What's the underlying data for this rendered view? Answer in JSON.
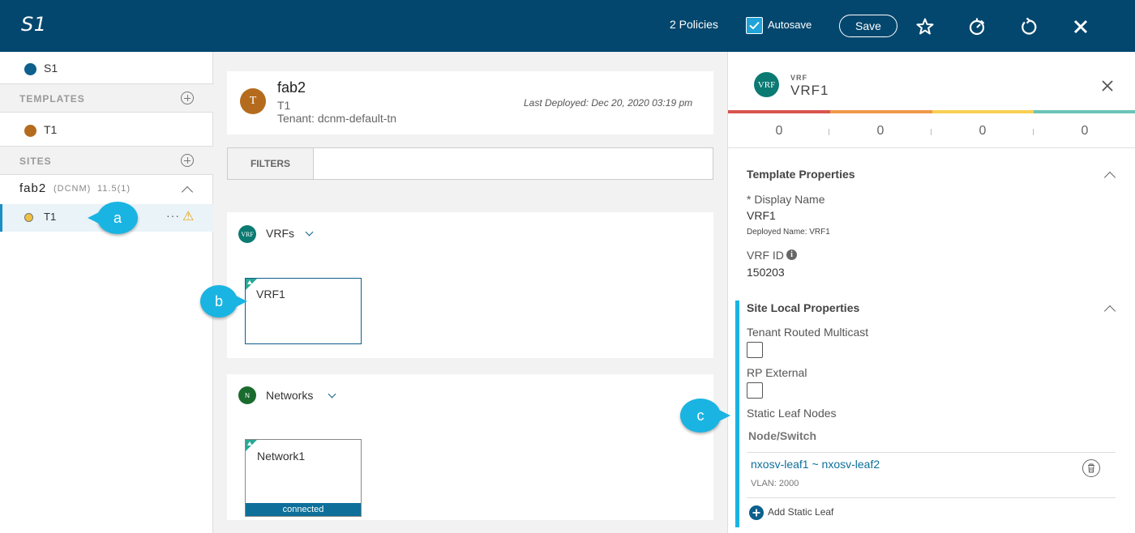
{
  "header": {
    "title": "S1",
    "policies": "2 Policies",
    "autosave_label": "Autosave",
    "save_label": "Save",
    "icons": [
      "star-icon",
      "deploy-icon",
      "refresh-icon",
      "close-icon"
    ],
    "background": "#04476e"
  },
  "sidebar": {
    "schema_label": "S1",
    "templates_heading": "TEMPLATES",
    "template_item": "T1",
    "sites_heading": "SITES",
    "site_name": "fab2",
    "site_type": "(DCNM)",
    "site_version": "11.5(1)",
    "site_template": "T1",
    "more_glyph": "···",
    "warning_glyph": "⚠"
  },
  "callouts": {
    "a": "a",
    "b": "b",
    "c": "c"
  },
  "main": {
    "template_avatar": "T",
    "site_title": "fab2",
    "template_name": "T1",
    "tenant": "Tenant: dcnm-default-tn",
    "last_deployed": "Last Deployed: Dec 20, 2020 03:19 pm",
    "filters_label": "FILTERS",
    "vrfs_avatar": "VRF",
    "vrfs_label": "VRFs",
    "vrf_tile": "VRF1",
    "networks_avatar": "N",
    "networks_label": "Networks",
    "network_tile": "Network1",
    "network_status": "connected"
  },
  "panel": {
    "avatar": "VRF",
    "type_label": "VRF",
    "name": "VRF1",
    "stats": [
      "0",
      "0",
      "0",
      "0"
    ],
    "stat_colors": [
      "#d9534f",
      "#f0994a",
      "#f7cf52",
      "#6cc4b6"
    ],
    "template_props_heading": "Template Properties",
    "display_name_label": "* Display Name",
    "display_name_value": "VRF1",
    "deployed_name": "Deployed Name: VRF1",
    "vrf_id_label": "VRF ID",
    "vrf_id_value": "150203",
    "site_local_heading": "Site Local Properties",
    "trm_label": "Tenant Routed Multicast",
    "rp_external_label": "RP External",
    "static_leaf_label": "Static Leaf Nodes",
    "node_switch_header": "Node/Switch",
    "leaf_pair": "nxosv-leaf1 ~ nxosv-leaf2",
    "vlan": "VLAN: 2000",
    "add_static_leaf": "Add Static Leaf"
  }
}
